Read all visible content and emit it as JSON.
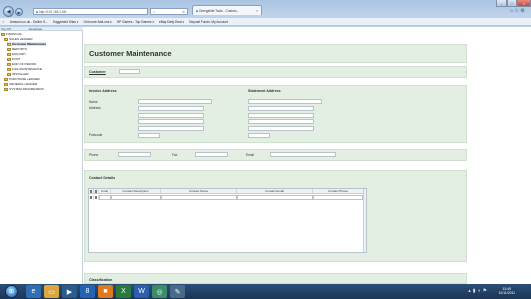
{
  "browser": {
    "address": "http://192.168.2.88/ …",
    "search_placeholder": "",
    "tab_title": "OmegaNet Tools - Custom...",
    "tab_close": "×",
    "window_controls": [
      "–",
      "□",
      "×"
    ],
    "favorites": [
      "Amazon.co.uk - Online S...",
      "Suggested Sites ▾",
      "Get more Add-ons ▾",
      "HP Games - Top Games ▾",
      "eBay Daily Deal ▾",
      "Deposit Funds: My Account"
    ]
  },
  "tree": {
    "header_left": "Top Off",
    "header_right": "Developer",
    "items": [
      {
        "label": "FINANCIAL",
        "level": 0
      },
      {
        "label": "SALES LEDGER",
        "level": 1
      },
      {
        "label": "Customer Maintenance",
        "level": 2,
        "selected": true
      },
      {
        "label": "REPORTS",
        "level": 2
      },
      {
        "label": "ENQUIRY",
        "level": 2
      },
      {
        "label": "POST",
        "level": 2
      },
      {
        "label": "END OF PERIOD",
        "level": 2
      },
      {
        "label": "FILE MAINTENANCE",
        "level": 2
      },
      {
        "label": "INSTALLER",
        "level": 2
      },
      {
        "label": "PURCHASE LEDGER",
        "level": 1
      },
      {
        "label": "GENERAL LEDGER",
        "level": 1
      },
      {
        "label": "SYSTEM PARAMETERS",
        "level": 1
      }
    ]
  },
  "form": {
    "title": "Customer Maintenance",
    "customer_label": "Customer",
    "customer_value": "",
    "invoice_heading": "Invoice Address",
    "statement_heading": "Statement Address",
    "name_label": "Name",
    "address_label": "Address",
    "postcode_label": "Postcode",
    "phone_label": "Phone",
    "fax_label": "Fax",
    "email_label": "Email",
    "contact_heading": "Contact Details",
    "contact_columns": [
      "Code",
      "Contact Description",
      "Contact Name",
      "Contact Email",
      "Contact Phone"
    ],
    "classification_heading": "Classification"
  },
  "taskbar": {
    "time": "13:49",
    "date": "10/11/2011",
    "apps": [
      "ie-icon",
      "folder-icon",
      "media-player-icon",
      "outlook-icon",
      "word-icon",
      "excel-icon",
      "app-icon",
      "paint-icon"
    ]
  }
}
